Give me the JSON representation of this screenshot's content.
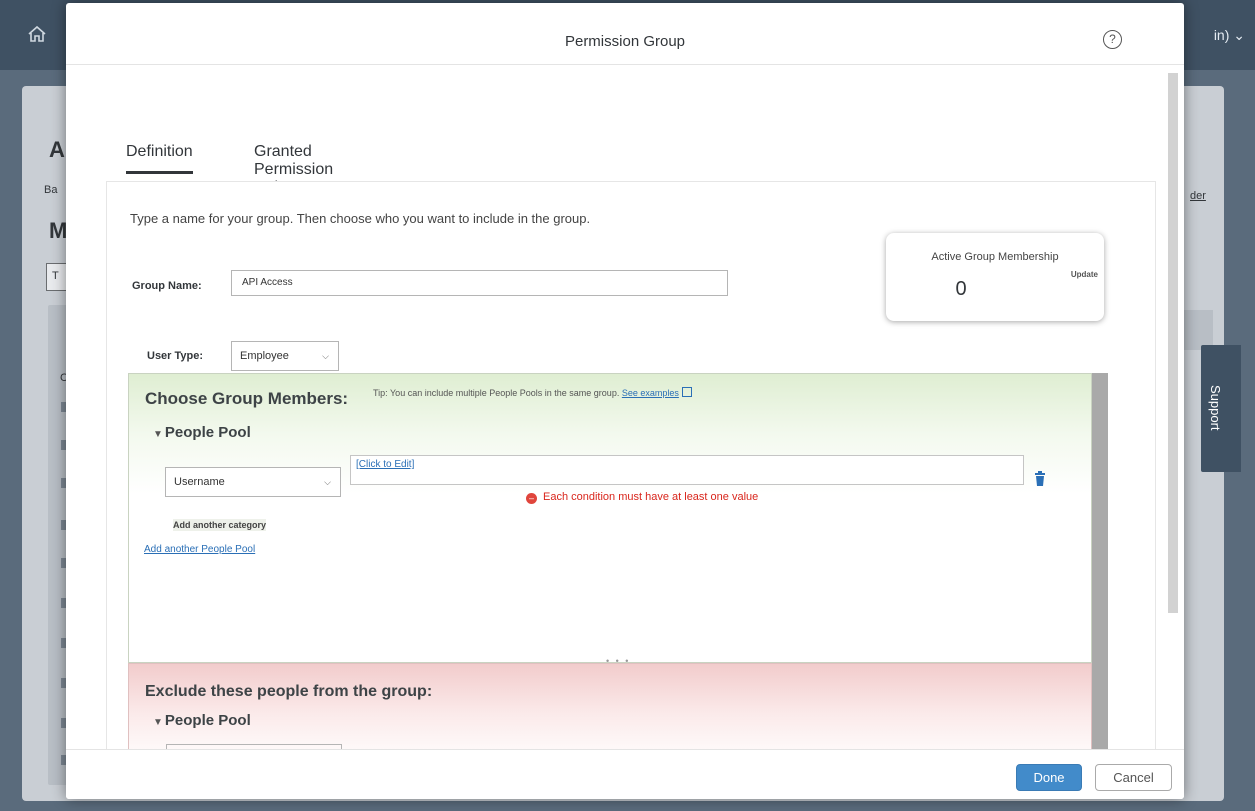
{
  "background": {
    "shell_user": "in) ⌄",
    "frag_a": "A",
    "frag_ba": "Ba",
    "frag_m": "M",
    "frag_t": "T",
    "frag_der": "der",
    "frag_c": "C",
    "support_label": "Support"
  },
  "dialog": {
    "title": "Permission Group",
    "help_glyph": "?",
    "tabs": [
      {
        "label": "Definition",
        "active": true
      },
      {
        "label": "Granted Permission Roles",
        "active": false
      }
    ],
    "intro": "Type a name for your group. Then choose who you want to include in the group.",
    "group_name_label": "Group Name:",
    "group_name_value": "API Access",
    "membership": {
      "title": "Active Group Membership",
      "update": "Update",
      "count": "0"
    },
    "user_type_label": "User Type:",
    "user_type_value": "Employee",
    "choose": {
      "heading": "Choose Group Members:",
      "tip": "Tip: You can include multiple People Pools in the same group.",
      "tip_link": "See examples",
      "pool_title": "People Pool",
      "category_value": "Username",
      "edit_link": "[Click to Edit]",
      "error": "Each condition must have at least one value",
      "add_category": "Add another category",
      "add_pool": "Add another People Pool"
    },
    "exclude": {
      "heading": "Exclude these people from the group:",
      "pool_title": "People Pool"
    },
    "splitter": "• • •",
    "footer": {
      "done": "Done",
      "cancel": "Cancel"
    }
  }
}
